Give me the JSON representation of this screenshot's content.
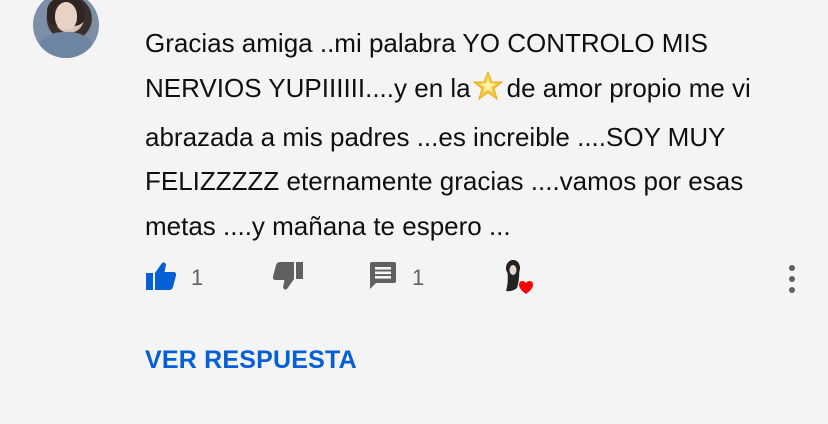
{
  "comment": {
    "author_partial": "▬▬▬▬ ▬▬▬▬▬ ▬▬▬▬▬",
    "text_lines": [
      "Gracias amiga ..mi palabra YO CONTROLO MIS",
      "NERVIOS YUPIIIIII....y en la",
      "de amor propio me vi",
      "abrazada a mis padres ...es increible ....SOY MUY",
      "FELIZZZZZ eternamente gracias ....vamos por esas",
      "metas ....y mañana te espero ..."
    ],
    "inline_icon": "star-emoji"
  },
  "actions": {
    "like_icon": "thumbs-up-icon",
    "like_count": "1",
    "dislike_icon": "thumbs-down-icon",
    "reply_icon": "comment-icon",
    "reply_count": "1",
    "heart_icon": "creator-heart-icon",
    "menu_icon": "more-vertical-icon"
  },
  "view_replies_label": "VER RESPUESTA",
  "colors": {
    "background": "#f4f4f4",
    "text": "#0f0f0f",
    "secondary": "#606060",
    "link_blue": "#065fd4",
    "heart_red": "#ff0000"
  }
}
